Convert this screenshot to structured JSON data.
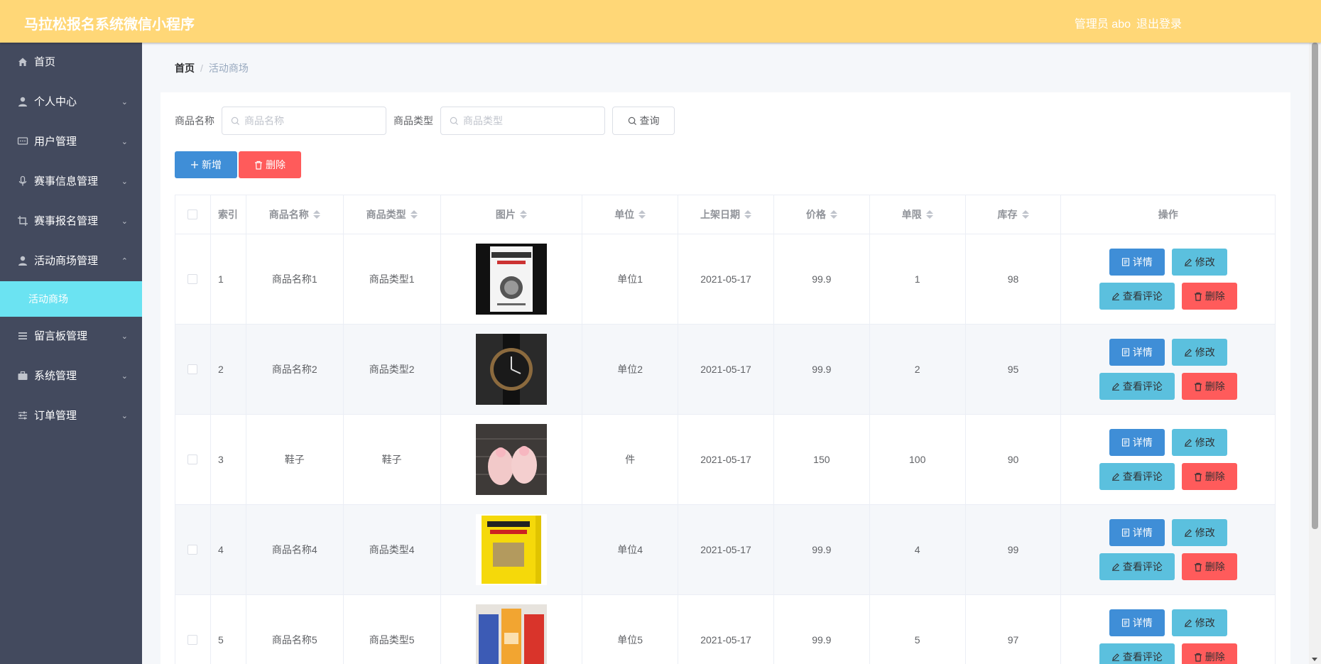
{
  "header": {
    "title": "马拉松报名系统微信小程序",
    "user": "管理员 abo",
    "logout": "退出登录"
  },
  "sidebar": {
    "items": [
      {
        "label": "首页",
        "icon": "home-icon"
      },
      {
        "label": "个人中心",
        "icon": "user-icon"
      },
      {
        "label": "用户管理",
        "icon": "chat-icon"
      },
      {
        "label": "赛事信息管理",
        "icon": "microphone-icon"
      },
      {
        "label": "赛事报名管理",
        "icon": "crop-icon"
      },
      {
        "label": "活动商场管理",
        "icon": "user-icon"
      },
      {
        "label": "留言板管理",
        "icon": "menu-icon"
      },
      {
        "label": "系统管理",
        "icon": "suitcase-icon"
      },
      {
        "label": "订单管理",
        "icon": "sliders-icon"
      }
    ],
    "active_sub": "活动商场"
  },
  "breadcrumb": {
    "home": "首页",
    "separator": "/",
    "current": "活动商场"
  },
  "search": {
    "name_label": "商品名称",
    "name_placeholder": "商品名称",
    "type_label": "商品类型",
    "type_placeholder": "商品类型",
    "query_label": "查询"
  },
  "actions": {
    "add_label": "新增",
    "delete_label": "删除"
  },
  "table": {
    "headers": {
      "index": "索引",
      "name": "商品名称",
      "type": "商品类型",
      "image": "图片",
      "unit": "单位",
      "date": "上架日期",
      "price": "价格",
      "limit": "单限",
      "stock": "库存",
      "ops": "操作"
    },
    "op_labels": {
      "detail": "详情",
      "edit": "修改",
      "comment": "查看评论",
      "delete": "删除"
    },
    "rows": [
      {
        "index": "1",
        "name": "商品名称1",
        "type": "商品类型1",
        "image": "book-cover",
        "unit": "单位1",
        "date": "2021-05-17",
        "price": "99.9",
        "limit": "1",
        "stock": "98"
      },
      {
        "index": "2",
        "name": "商品名称2",
        "type": "商品类型2",
        "image": "watch",
        "unit": "单位2",
        "date": "2021-05-17",
        "price": "99.9",
        "limit": "2",
        "stock": "95"
      },
      {
        "index": "3",
        "name": "鞋子",
        "type": "鞋子",
        "image": "pink-shoes",
        "unit": "件",
        "date": "2021-05-17",
        "price": "150",
        "limit": "100",
        "stock": "90"
      },
      {
        "index": "4",
        "name": "商品名称4",
        "type": "商品类型4",
        "image": "yellow-book",
        "unit": "单位4",
        "date": "2021-05-17",
        "price": "99.9",
        "limit": "4",
        "stock": "99"
      },
      {
        "index": "5",
        "name": "商品名称5",
        "type": "商品类型5",
        "image": "drink-cartons",
        "unit": "单位5",
        "date": "2021-05-17",
        "price": "99.9",
        "limit": "5",
        "stock": "97"
      }
    ]
  },
  "colors": {
    "header_bg": "#ffd777",
    "sidebar_bg": "#434a5e",
    "active_sub_bg": "#6be3f2",
    "primary": "#3f8ed7",
    "info": "#5bc0de",
    "danger": "#ff5b5b"
  }
}
